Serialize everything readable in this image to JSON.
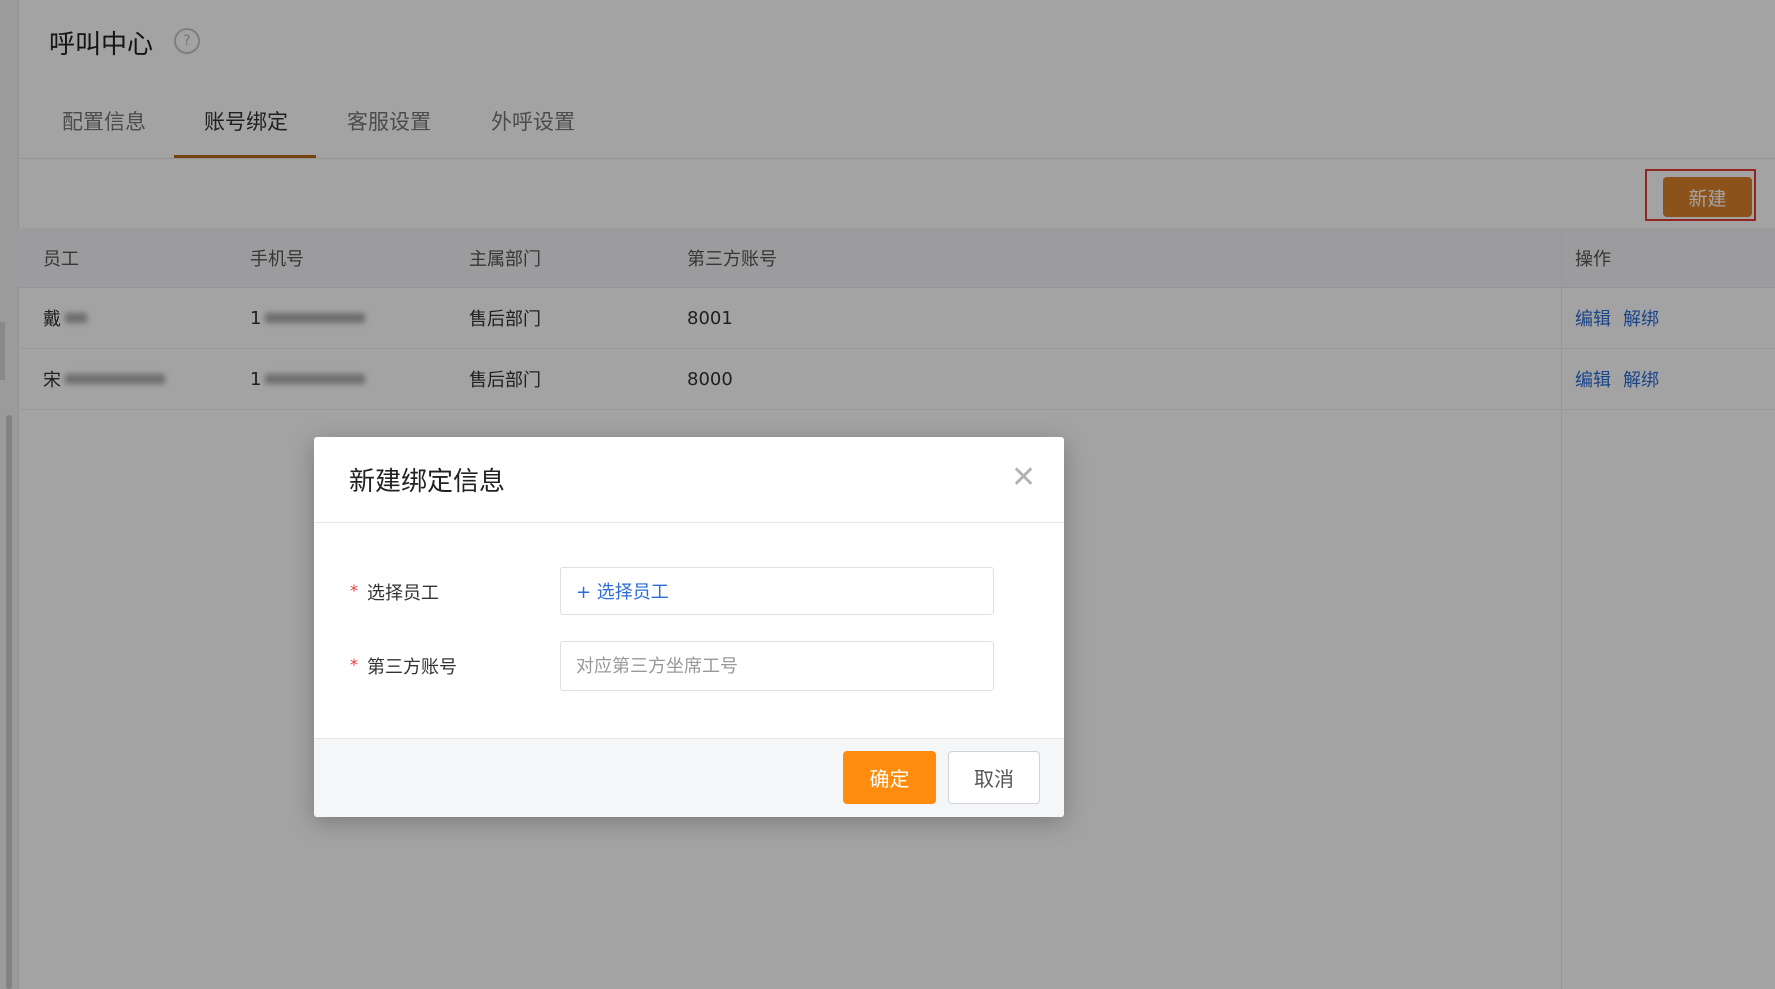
{
  "page": {
    "title": "呼叫中心",
    "help_icon": "question-circle-icon",
    "help_glyph": "?"
  },
  "tabs": [
    {
      "label": "配置信息",
      "active": false
    },
    {
      "label": "账号绑定",
      "active": true
    },
    {
      "label": "客服设置",
      "active": false
    },
    {
      "label": "外呼设置",
      "active": false
    }
  ],
  "toolbar": {
    "new_label": "新建"
  },
  "table": {
    "headers": {
      "employee": "员工",
      "phone": "手机号",
      "department": "主属部门",
      "third_party": "第三方账号",
      "actions": "操作"
    },
    "rows": [
      {
        "employee": "戴",
        "phone": "1",
        "department": "售后部门",
        "third_party": "8001",
        "edit": "编辑",
        "unbind": "解绑"
      },
      {
        "employee": "宋",
        "phone": "1",
        "department": "售后部门",
        "third_party": "8000",
        "edit": "编辑",
        "unbind": "解绑"
      }
    ]
  },
  "modal": {
    "title": "新建绑定信息",
    "close_glyph": "✕",
    "fields": [
      {
        "label": "选择员工",
        "required_mark": "*",
        "value": "+ 选择员工"
      },
      {
        "label": "第三方账号",
        "required_mark": "*",
        "placeholder": "对应第三方坐席工号"
      }
    ],
    "confirm_label": "确定",
    "cancel_label": "取消"
  },
  "colors": {
    "accent": "#ff8c0d",
    "tab_underline": "#b86a16",
    "link": "#2b6cd6",
    "required": "#e53935",
    "highlight_border": "#e53935"
  }
}
